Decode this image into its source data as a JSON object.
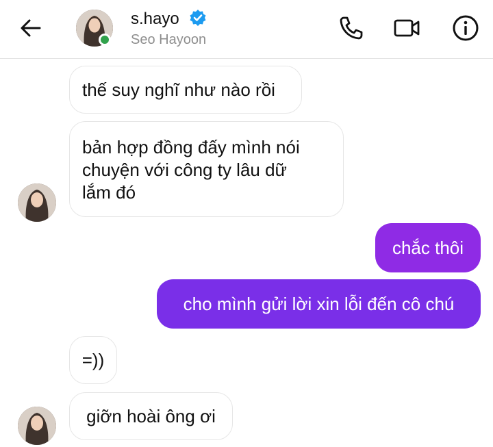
{
  "header": {
    "username": "s.hayo",
    "display_name": "Seo Hayoon",
    "icons": {
      "back": "arrow-left-icon",
      "verified": "verified-badge-icon",
      "call": "phone-icon",
      "video": "video-camera-icon",
      "info": "info-icon"
    },
    "online": true
  },
  "messages": [
    {
      "side": "in",
      "text": "thế suy nghĩ như nào rồi"
    },
    {
      "side": "in",
      "lines": [
        "bản hợp đồng đấy mình nói",
        "chuyện với công ty lâu dữ",
        "lắm đó"
      ]
    },
    {
      "side": "out",
      "text": "chắc thôi"
    },
    {
      "side": "out",
      "text": "cho mình gửi lời xin lỗi đến cô chú"
    },
    {
      "side": "in",
      "text": "=))"
    },
    {
      "side": "in",
      "text": "giỡn hoài ông ơi"
    }
  ],
  "colors": {
    "outgoing_bubble": "#8f2be5",
    "verified_badge": "#1d9bf0",
    "online_dot": "#31a24c"
  }
}
